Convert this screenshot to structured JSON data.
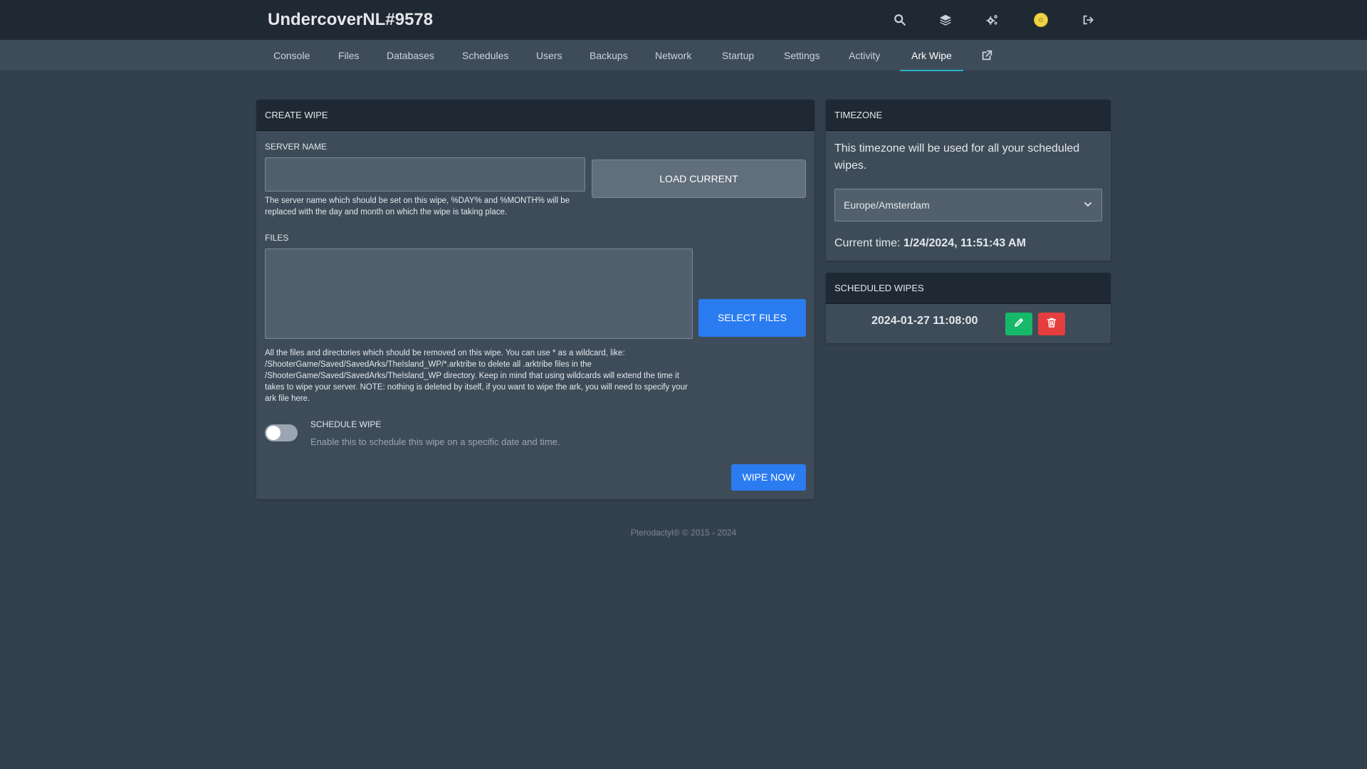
{
  "header": {
    "title": "UndercoverNL#9578",
    "icons": [
      "search-icon",
      "layers-icon",
      "cogs-icon",
      "avatar",
      "sign-out-icon"
    ]
  },
  "nav": {
    "items": [
      {
        "label": "Console"
      },
      {
        "label": "Files"
      },
      {
        "label": "Databases"
      },
      {
        "label": "Schedules"
      },
      {
        "label": "Users"
      },
      {
        "label": "Backups"
      },
      {
        "label": "Network"
      },
      {
        "label": "Startup"
      },
      {
        "label": "Settings"
      },
      {
        "label": "Activity"
      },
      {
        "label": "Ark Wipe"
      }
    ],
    "active": "Ark Wipe",
    "external_icon": "external-link-icon"
  },
  "create_wipe": {
    "title": "CREATE WIPE",
    "server_name_label": "SERVER NAME",
    "server_name_value": "",
    "load_current_label": "LOAD CURRENT",
    "server_name_help": "The server name which should be set on this wipe, %DAY% and %MONTH% will be replaced with the day and month on which the wipe is taking place.",
    "files_label": "FILES",
    "files_value": "",
    "select_files_label": "SELECT FILES",
    "files_help": "All the files and directories which should be removed on this wipe. You can use * as a wildcard, like: /ShooterGame/Saved/SavedArks/TheIsland_WP/*.arktribe to delete all .arktribe files in the /ShooterGame/Saved/SavedArks/TheIsland_WP directory. Keep in mind that using wildcards will extend the time it takes to wipe your server. NOTE: nothing is deleted by itself, if you want to wipe the ark, you will need to specify your ark file here.",
    "schedule_label": "SCHEDULE WIPE",
    "schedule_help": "Enable this to schedule this wipe on a specific date and time.",
    "schedule_enabled": false,
    "wipe_now_label": "WIPE NOW"
  },
  "timezone": {
    "title": "TIMEZONE",
    "description": "This timezone will be used for all your scheduled wipes.",
    "selected": "Europe/Amsterdam",
    "current_time_label": "Current time:",
    "current_time_value": "1/24/2024, 11:51:43 AM"
  },
  "scheduled_wipes": {
    "title": "SCHEDULED WIPES",
    "items": [
      {
        "datetime": "2024-01-27 11:08:00"
      }
    ]
  },
  "footer": {
    "text": "Pterodactyl® © 2015 - 2024"
  },
  "colors": {
    "accent_blue": "#2b7cf0",
    "edit_green": "#16b96a",
    "delete_red": "#e53e3e",
    "active_tab_underline": "#2bb0c4"
  }
}
